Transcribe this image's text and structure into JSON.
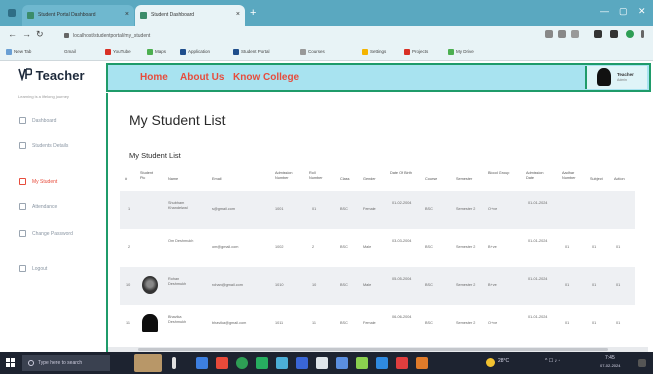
{
  "browser": {
    "tabs": [
      {
        "label": "Student Portal Dashboard"
      },
      {
        "label": "Student Dashboard"
      }
    ],
    "new_tab": "+",
    "url": "localhost/studentportal/my_student",
    "bookmarks": [
      "New Tab",
      "Gmail",
      "YouTube",
      "Maps",
      "Application",
      "Student Portal",
      "Courses",
      "Settings",
      "Projects",
      "My Drive"
    ]
  },
  "sidebar": {
    "brand": "Teacher",
    "brand_sub": "Learning is a lifelong journey",
    "items": [
      {
        "label": "Dashboard",
        "active": false
      },
      {
        "label": "Students Details",
        "active": false
      },
      {
        "label": "My Student",
        "active": true
      },
      {
        "label": "Attendance",
        "active": false
      },
      {
        "label": "Change Password",
        "active": false
      },
      {
        "label": "Logout",
        "active": false
      }
    ]
  },
  "header": {
    "nav": [
      "Home",
      "About Us",
      "Know College"
    ],
    "profile_name": "Teacher",
    "profile_role": "Admin"
  },
  "main": {
    "title": "My Student List",
    "subtitle": "My Student List",
    "columns": [
      "#",
      "Student Pic",
      "Name",
      "Email",
      "Admission Number",
      "Roll Number",
      "Class",
      "Gender",
      "Date Of Birth",
      "Course",
      "Semester",
      "Blood Group",
      "Admission Date",
      "Aadhar Number",
      "Subject",
      "Action"
    ],
    "rows": [
      {
        "num": "1",
        "photo": "",
        "name": "Shubham Khandelwal",
        "email": "s@gmail.com",
        "adm": "1001",
        "roll": "01",
        "cls": "BSC",
        "gender": "Female",
        "dob": "01-02-2004",
        "course": "BSC",
        "sem": "Semester 2",
        "blood": "O+ve",
        "adate": "01-01-2024",
        "aadhar": "",
        "subj": "",
        "action": ""
      },
      {
        "num": "2",
        "photo": "",
        "name": "Om Deshmukh",
        "email": "om@gmail.com",
        "adm": "1002",
        "roll": "2",
        "cls": "BSC",
        "gender": "Male",
        "dob": "03-03-2004",
        "course": "BSC",
        "sem": "Semester 2",
        "blood": "B+ve",
        "adate": "01-01-2024",
        "aadhar": "01",
        "subj": "01",
        "action": "01"
      },
      {
        "num": "10",
        "photo": "round",
        "name": "Rohan Deshmukh",
        "email": "rohan@gmail.com",
        "adm": "1010",
        "roll": "10",
        "cls": "BSC",
        "gender": "Male",
        "dob": "05-05-2004",
        "course": "BSC",
        "sem": "Semester 2",
        "blood": "B+ve",
        "adate": "01-01-2024",
        "aadhar": "01",
        "subj": "01",
        "action": "01"
      },
      {
        "num": "11",
        "photo": "dark",
        "name": "Bhavika Deshmukh",
        "email": "bhavika@gmail.com",
        "adm": "1011",
        "roll": "11",
        "cls": "BSC",
        "gender": "Female",
        "dob": "06-06-2004",
        "course": "BSC",
        "sem": "Semester 2",
        "blood": "O+ve",
        "adate": "01-01-2024",
        "aadhar": "01",
        "subj": "01",
        "action": "01"
      }
    ]
  },
  "taskbar": {
    "search_placeholder": "Type here to search",
    "weather": "28°C",
    "time": "7:45",
    "date": "07-02-2024"
  },
  "colors": {
    "header_bg": "#a8e3f0",
    "accent_green": "#1f9b6a",
    "nav_red": "#e74c3c",
    "tabbar": "#5aa8c0"
  }
}
